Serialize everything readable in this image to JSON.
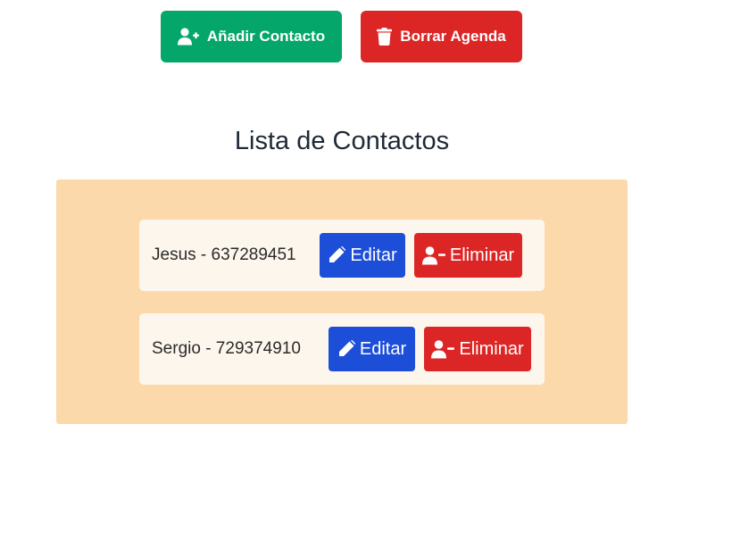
{
  "toolbar": {
    "add_label": "Añadir Contacto",
    "add_icon": "user-plus-icon",
    "clear_label": "Borrar Agenda",
    "clear_icon": "trash-icon"
  },
  "list": {
    "title": "Lista de Contactos",
    "contacts": [
      {
        "text": "Jesus - 637289451",
        "edit_label": "Editar",
        "delete_label": "Eliminar"
      },
      {
        "text": "Sergio - 729374910",
        "edit_label": "Editar",
        "delete_label": "Eliminar"
      }
    ]
  },
  "colors": {
    "add_button": "#04a66a",
    "clear_button": "#dc2626",
    "edit_button": "#1d4ed8",
    "delete_button": "#dc2626",
    "panel_background": "#fcd9aa",
    "card_background": "#fdf6ed"
  }
}
